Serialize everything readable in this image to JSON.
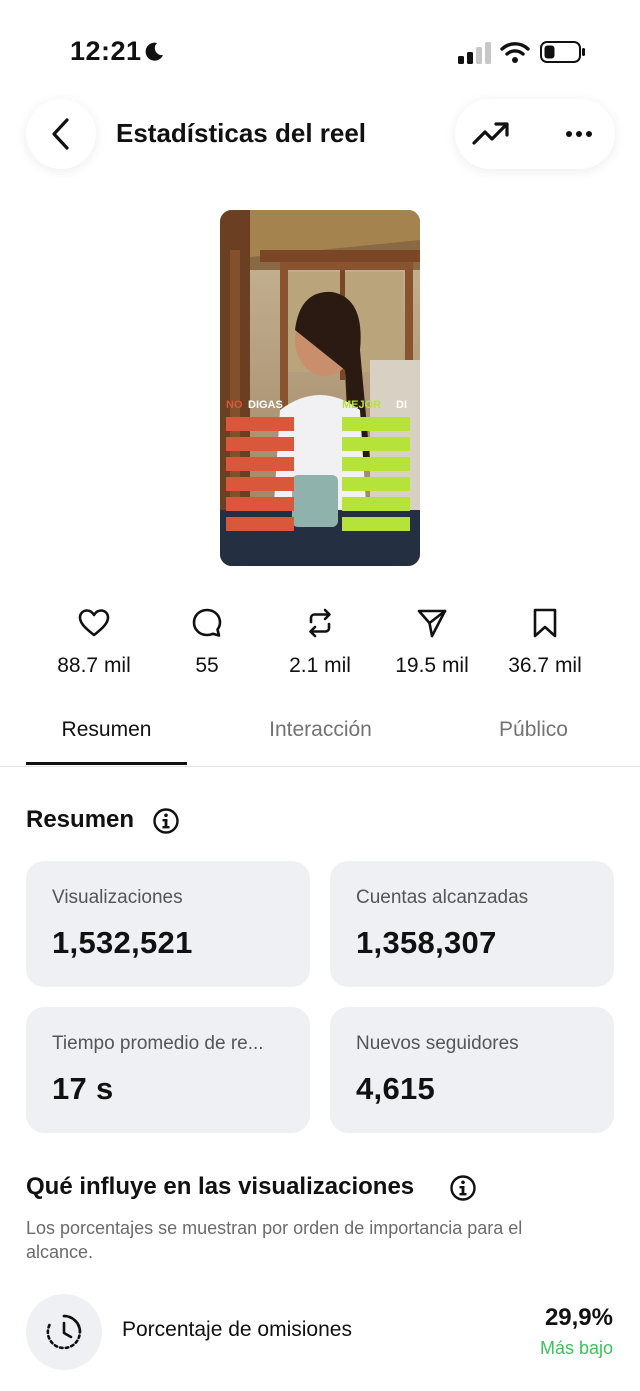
{
  "status_bar": {
    "time": "12:21"
  },
  "header": {
    "title": "Estadísticas del reel"
  },
  "metrics": [
    {
      "icon": "heart-icon",
      "value": "88.7 mil"
    },
    {
      "icon": "comment-icon",
      "value": "55"
    },
    {
      "icon": "repost-icon",
      "value": "2.1 mil"
    },
    {
      "icon": "share-icon",
      "value": "19.5 mil"
    },
    {
      "icon": "bookmark-icon",
      "value": "36.7 mil"
    }
  ],
  "tabs": [
    {
      "label": "Resumen",
      "active": true
    },
    {
      "label": "Interacción",
      "active": false
    },
    {
      "label": "Público",
      "active": false
    }
  ],
  "thumbnail": {
    "left_caption_red": "NO",
    "left_caption_white": "DIGAS",
    "right_caption_green": "MEJOR",
    "right_caption_white": "DI"
  },
  "summary": {
    "title": "Resumen",
    "cards": [
      {
        "label": "Visualizaciones",
        "value": "1,532,521"
      },
      {
        "label": "Cuentas alcanzadas",
        "value": "1,358,307"
      },
      {
        "label": "Tiempo promedio de re...",
        "value": "17 s"
      },
      {
        "label": "Nuevos seguidores",
        "value": "4,615"
      }
    ]
  },
  "influence": {
    "title": "Qué influye en las visualizaciones",
    "description": "Los porcentajes se muestran por orden de importancia para el alcance.",
    "rows": [
      {
        "icon": "timer-icon",
        "label": "Porcentaje de omisiones",
        "value": "29,9%",
        "sub": "Más bajo"
      }
    ]
  },
  "colors": {
    "positive": "#39c25e",
    "card_bg": "#eff0f4",
    "caption_red": "#d9573a",
    "caption_green": "#b6e33a"
  }
}
